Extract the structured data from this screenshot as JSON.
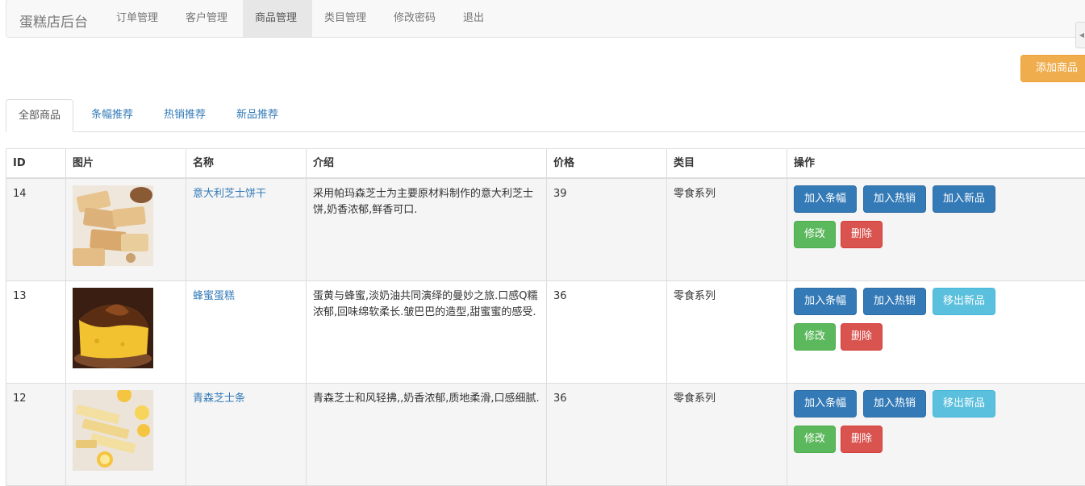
{
  "navbar": {
    "brand": "蛋糕店后台",
    "items": [
      {
        "label": "订单管理",
        "active": false
      },
      {
        "label": "客户管理",
        "active": false
      },
      {
        "label": "商品管理",
        "active": true
      },
      {
        "label": "类目管理",
        "active": false
      },
      {
        "label": "修改密码",
        "active": false
      },
      {
        "label": "退出",
        "active": false
      }
    ]
  },
  "toolbar": {
    "add_label": "添加商品"
  },
  "tabs": [
    {
      "label": "全部商品",
      "active": true
    },
    {
      "label": "条幅推荐",
      "active": false
    },
    {
      "label": "热销推荐",
      "active": false
    },
    {
      "label": "新品推荐",
      "active": false
    }
  ],
  "table": {
    "headers": [
      "ID",
      "图片",
      "名称",
      "介绍",
      "价格",
      "类目",
      "操作"
    ],
    "rows": [
      {
        "id": "14",
        "name": "意大利芝士饼干",
        "desc": "采用帕玛森芝士为主要原材料制作的意大利芝士饼,奶香浓郁,鲜香可口.",
        "price": "39",
        "category": "零食系列",
        "image_icon": "cheese-biscuit-photo",
        "btn_banner": "加入条幅",
        "btn_hot": "加入热销",
        "btn_new": "加入新品",
        "btn_edit": "修改",
        "btn_delete": "删除"
      },
      {
        "id": "13",
        "name": "蜂蜜蛋糕",
        "desc": "蛋黄与蜂蜜,淡奶油共同演绎的曼妙之旅.口感Q糯浓郁,回味绵软柔长.皱巴巴的造型,甜蜜蜜的感受.",
        "price": "36",
        "category": "零食系列",
        "image_icon": "honey-cake-photo",
        "btn_banner": "加入条幅",
        "btn_hot": "加入热销",
        "btn_new": "移出新品",
        "btn_edit": "修改",
        "btn_delete": "删除"
      },
      {
        "id": "12",
        "name": "青森芝士条",
        "desc": "青森芝士和风轻拂,,奶香浓郁,质地柔滑,口感细腻.",
        "price": "36",
        "category": "零食系列",
        "image_icon": "cheese-stick-photo",
        "btn_banner": "加入条幅",
        "btn_hot": "加入热销",
        "btn_new": "移出新品",
        "btn_edit": "修改",
        "btn_delete": "删除"
      }
    ]
  },
  "colors": {
    "primary": "#337ab7",
    "info": "#5bc0de",
    "success": "#5cb85c",
    "danger": "#d9534f",
    "warning": "#f0ad4e"
  }
}
